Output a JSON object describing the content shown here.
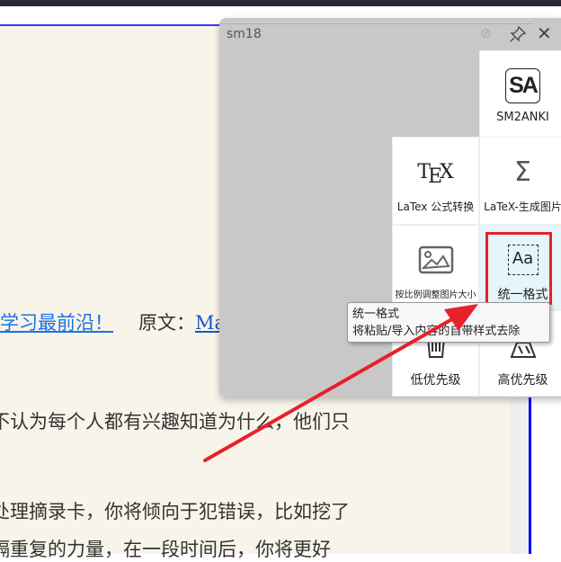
{
  "document": {
    "link_text": "学习最前沿！",
    "source_label": "原文：",
    "source_link": "MasterHowT",
    "lines": [
      "不认为每个人都有兴趣知道为什么，他们只",
      "处理摘录卡，你将倾向于犯错误，比如挖了",
      "隔重复的力量，在一段时间后，你将更好"
    ]
  },
  "panel": {
    "title": "sm18",
    "tiles": [
      {
        "label": "SM2ANKI",
        "icon": "SA"
      },
      {
        "label": "LaTex 公式转换",
        "icon": "TeX"
      },
      {
        "label": "LaTeX-生成图片",
        "icon": "Σ"
      },
      {
        "label": "按比例调整图片大小",
        "icon": "image"
      },
      {
        "label": "统一格式",
        "icon": "Aa"
      },
      {
        "label": "低优先级",
        "icon": "trash"
      },
      {
        "label": "高优先级",
        "icon": "priority"
      }
    ]
  },
  "tooltip": {
    "title": "统一格式",
    "description": "将粘贴/导入内容的自带样式去除"
  },
  "colors": {
    "highlight": "#e5f5fb",
    "annotation": "#e8202a"
  }
}
